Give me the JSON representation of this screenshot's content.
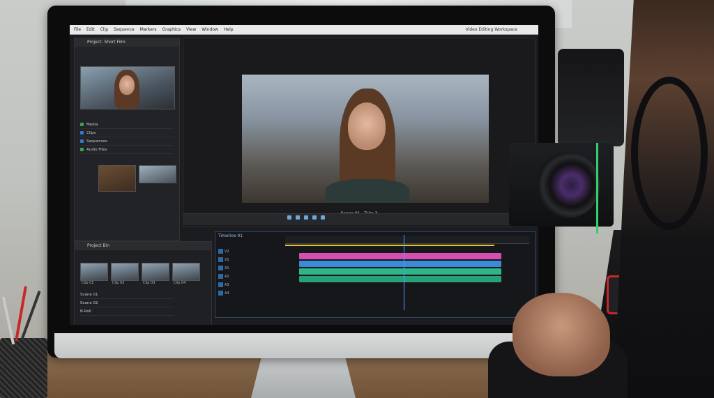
{
  "app": {
    "menu": [
      "File",
      "Edit",
      "Clip",
      "Sequence",
      "Markers",
      "Graphics",
      "View",
      "Window",
      "Help"
    ],
    "title": "Video Editing Workspace"
  },
  "source_panel": {
    "header": "Project: Short Film",
    "list": [
      {
        "label": "Media",
        "color": "#3fa14a"
      },
      {
        "label": "Clips",
        "color": "#2f7ad0"
      },
      {
        "label": "Sequences",
        "color": "#2f7ad0"
      },
      {
        "label": "Audio Files",
        "color": "#3fa14a"
      }
    ]
  },
  "program_panel": {
    "caption": "Scene 01 - Take 3"
  },
  "bin_panel": {
    "header": "Project Bin",
    "items": [
      "Clip 01",
      "Clip 02",
      "Clip 03",
      "Clip 04"
    ],
    "list": [
      "Scene 01",
      "Scene 02",
      "B-Roll"
    ]
  },
  "timeline_panel": {
    "header": "Timeline 01",
    "tracks": [
      "V2",
      "V1",
      "A1",
      "A2",
      "A3",
      "A4"
    ]
  },
  "colors": {
    "accent": "#4aa3ff",
    "clip_pink": "#d34fb0",
    "clip_blue": "#3a8bd6",
    "audio_green": "#2fb58a",
    "playhead_yellow": "#e7c23b"
  }
}
